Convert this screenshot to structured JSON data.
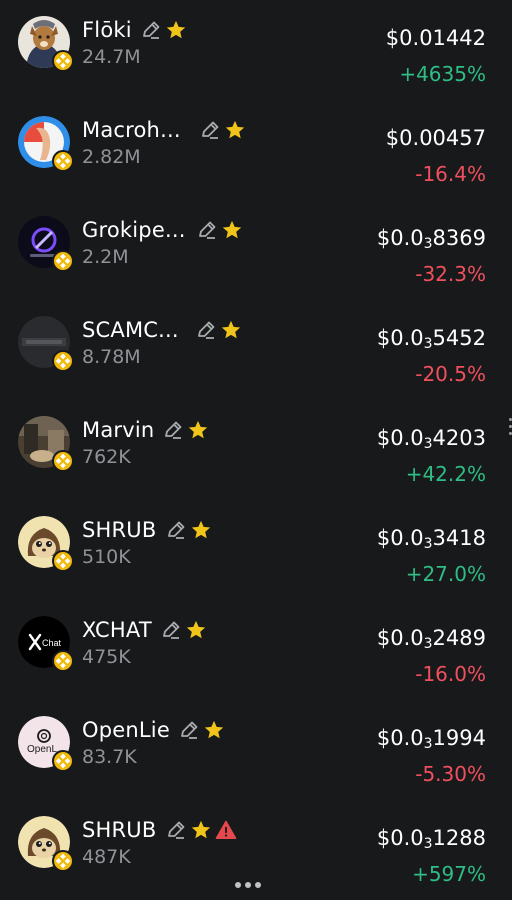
{
  "tokens": [
    {
      "name": "Flōki",
      "holders": "24.7M",
      "price_prefix": "$0.01442",
      "price_zeros": "",
      "price_digits": "",
      "change": "+4635%",
      "change_color": "pos",
      "warning": false,
      "avatar_icon": "floki-avatar-icon"
    },
    {
      "name": "Macroh...",
      "holders": "2.82M",
      "price_prefix": "$0.00457",
      "price_zeros": "",
      "price_digits": "",
      "change": "-16.4%",
      "change_color": "neg",
      "warning": false,
      "avatar_icon": "macroh-avatar-icon"
    },
    {
      "name": "Grokipe...",
      "holders": "2.2M",
      "price_prefix": "$0.0",
      "price_zeros": "3",
      "price_digits": "8369",
      "change": "-32.3%",
      "change_color": "neg",
      "warning": false,
      "avatar_icon": "grokipedia-avatar-icon"
    },
    {
      "name": "SCAMC...",
      "holders": "8.78M",
      "price_prefix": "$0.0",
      "price_zeros": "3",
      "price_digits": "5452",
      "change": "-20.5%",
      "change_color": "neg",
      "warning": false,
      "avatar_icon": "scamc-avatar-icon"
    },
    {
      "name": "Marvin",
      "holders": "762K",
      "price_prefix": "$0.0",
      "price_zeros": "3",
      "price_digits": "4203",
      "change": "+42.2%",
      "change_color": "pos",
      "warning": false,
      "avatar_icon": "marvin-avatar-icon"
    },
    {
      "name": "SHRUB",
      "holders": "510K",
      "price_prefix": "$0.0",
      "price_zeros": "3",
      "price_digits": "3418",
      "change": "+27.0%",
      "change_color": "pos",
      "warning": false,
      "avatar_icon": "shrub-avatar-icon"
    },
    {
      "name": "XCHAT",
      "holders": "475K",
      "price_prefix": "$0.0",
      "price_zeros": "3",
      "price_digits": "2489",
      "change": "-16.0%",
      "change_color": "neg",
      "warning": false,
      "avatar_icon": "xchat-avatar-icon"
    },
    {
      "name": "OpenLie",
      "holders": "83.7K",
      "price_prefix": "$0.0",
      "price_zeros": "3",
      "price_digits": "1994",
      "change": "-5.30%",
      "change_color": "neg",
      "warning": false,
      "avatar_icon": "openlie-avatar-icon"
    },
    {
      "name": "SHRUB",
      "holders": "487K",
      "price_prefix": "$0.0",
      "price_zeros": "3",
      "price_digits": "1288",
      "change": "+597%",
      "change_color": "pos",
      "warning": true,
      "avatar_icon": "shrub-avatar-icon"
    }
  ],
  "avatar_text": {
    "xchat": "Chat",
    "openlie": "OpenL"
  },
  "colors": {
    "background": "#18191b",
    "positive": "#2fbd85",
    "negative": "#f0505e",
    "muted": "#8f9296",
    "star": "#f0c419",
    "chain_badge": "#f0b90b",
    "warning": "#e5484d"
  }
}
